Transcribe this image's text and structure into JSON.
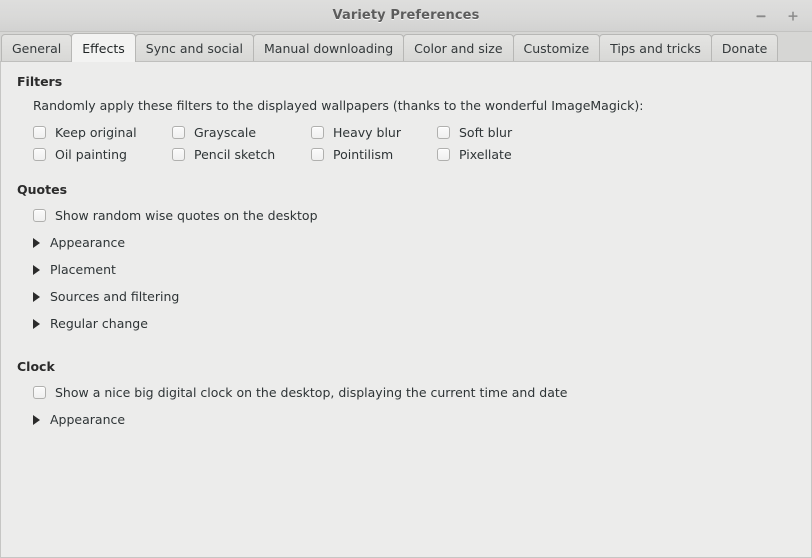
{
  "window": {
    "title": "Variety Preferences",
    "controls": [
      {
        "name": "minimize",
        "glyph": "minimize-icon"
      },
      {
        "name": "maximize",
        "glyph": "maximize-icon"
      }
    ]
  },
  "tabs": [
    {
      "label": "General",
      "active": false
    },
    {
      "label": "Effects",
      "active": true
    },
    {
      "label": "Sync and social",
      "active": false
    },
    {
      "label": "Manual downloading",
      "active": false
    },
    {
      "label": "Color and size",
      "active": false
    },
    {
      "label": "Customize",
      "active": false
    },
    {
      "label": "Tips and tricks",
      "active": false
    },
    {
      "label": "Donate",
      "active": false
    }
  ],
  "sections": {
    "filters": {
      "title": "Filters",
      "description": "Randomly apply these filters to the displayed wallpapers (thanks to the wonderful ImageMagick):",
      "checkboxes": [
        {
          "label": "Keep original",
          "checked": false
        },
        {
          "label": "Grayscale",
          "checked": false
        },
        {
          "label": "Heavy blur",
          "checked": false
        },
        {
          "label": "Soft blur",
          "checked": false
        },
        {
          "label": "Oil painting",
          "checked": false
        },
        {
          "label": "Pencil sketch",
          "checked": false
        },
        {
          "label": "Pointilism",
          "checked": false
        },
        {
          "label": "Pixellate",
          "checked": false
        }
      ]
    },
    "quotes": {
      "title": "Quotes",
      "checkbox": {
        "label": "Show random wise quotes on the desktop",
        "checked": false
      },
      "expanders": [
        {
          "label": "Appearance",
          "expanded": false
        },
        {
          "label": "Placement",
          "expanded": false
        },
        {
          "label": "Sources and filtering",
          "expanded": false
        },
        {
          "label": "Regular change",
          "expanded": false
        }
      ]
    },
    "clock": {
      "title": "Clock",
      "checkbox": {
        "label": "Show a nice big digital clock on the desktop, displaying the current time and date",
        "checked": false
      },
      "expanders": [
        {
          "label": "Appearance",
          "expanded": false
        }
      ]
    }
  },
  "colors": {
    "titlebar": "#d9d9d8",
    "tabbar": "#d6d6d4",
    "content": "#ececeb",
    "active_tab": "#f3f3f2",
    "text": "#2e3436",
    "title_text": "#5c5c5c"
  }
}
